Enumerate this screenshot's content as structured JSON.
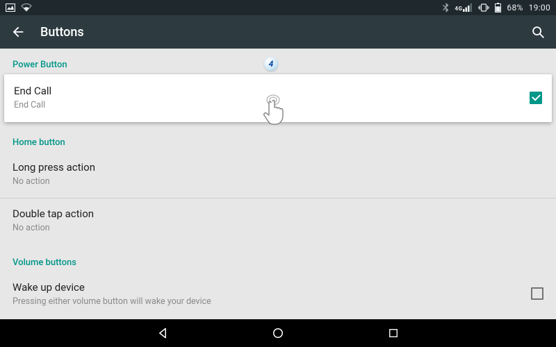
{
  "status": {
    "battery_text": "68%",
    "clock": "19:00",
    "network_label": "4G"
  },
  "appbar": {
    "title": "Buttons"
  },
  "sections": {
    "power": {
      "header": "Power Button",
      "end_call": {
        "title": "End Call",
        "subtitle": "End Call",
        "checked": true
      }
    },
    "home": {
      "header": "Home button",
      "long_press": {
        "title": "Long press action",
        "subtitle": "No action"
      },
      "double_tap": {
        "title": "Double tap action",
        "subtitle": "No action"
      }
    },
    "volume": {
      "header": "Volume buttons",
      "wake": {
        "title": "Wake up device",
        "subtitle": "Pressing either volume button will wake your device",
        "checked": false
      }
    }
  },
  "tutorial": {
    "step": "4"
  },
  "colors": {
    "accent": "#009688"
  }
}
